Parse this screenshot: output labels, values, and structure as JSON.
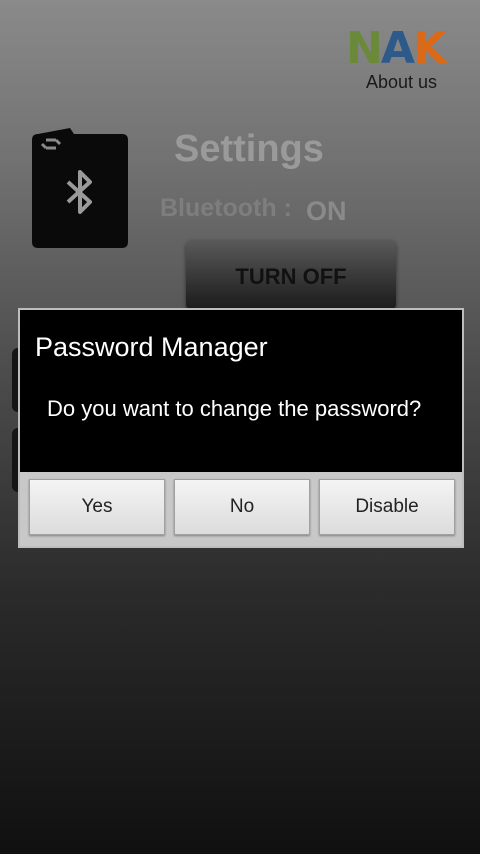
{
  "header": {
    "logo_text": "NAK",
    "about_label": "About us"
  },
  "settings": {
    "title": "Settings",
    "bluetooth_label": "Bluetooth :",
    "bluetooth_state": "ON",
    "toggle_button_label": "TURN OFF"
  },
  "dialog": {
    "title": "Password Manager",
    "message": "Do you want to change the password?",
    "buttons": {
      "yes": "Yes",
      "no": "No",
      "disable": "Disable"
    }
  },
  "colors": {
    "logo_n": "#6a8a3a",
    "logo_a": "#2d5a8a",
    "logo_k": "#d86a1a",
    "dialog_bg": "#000000",
    "dialog_actions_bg": "#c8c8c8"
  }
}
